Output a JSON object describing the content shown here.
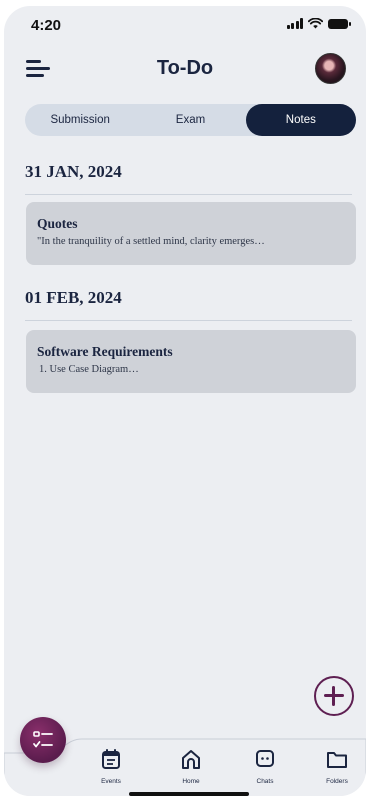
{
  "status_bar": {
    "time": "4:20"
  },
  "header": {
    "title": "To-Do"
  },
  "tabs": [
    {
      "label": "Submission",
      "active": false
    },
    {
      "label": "Exam",
      "active": false
    },
    {
      "label": "Notes",
      "active": true
    }
  ],
  "sections": [
    {
      "date": "31 JAN, 2024",
      "notes": [
        {
          "title": "Quotes",
          "snippet": "\"In the tranquility of a settled mind, clarity emerges…"
        }
      ]
    },
    {
      "date": "01 FEB, 2024",
      "notes": [
        {
          "title": "Software Requirements",
          "snippet": "1. Use Case Diagram…"
        }
      ]
    }
  ],
  "bottom_nav": [
    {
      "label": "Events",
      "icon": "calendar-icon"
    },
    {
      "label": "Home",
      "icon": "home-icon"
    },
    {
      "label": "Chats",
      "icon": "chat-icon"
    },
    {
      "label": "Folders",
      "icon": "folder-icon"
    }
  ],
  "colors": {
    "primary": "#14213d",
    "accent": "#5e1f52",
    "background": "#eceef2",
    "card": "#cfd2d8"
  }
}
